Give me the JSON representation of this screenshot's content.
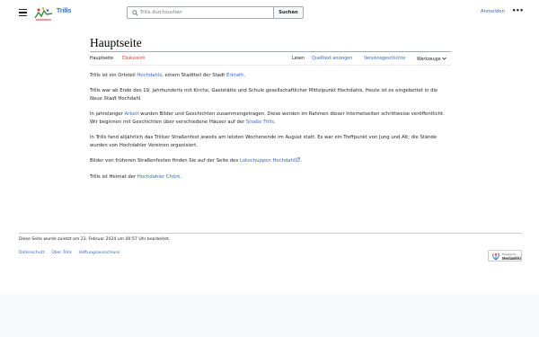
{
  "header": {
    "site_name": "Trills",
    "search_placeholder": "Trills durchsuchen",
    "search_button": "Suchen",
    "login": "Anmelden",
    "more": "•••"
  },
  "page": {
    "title": "Hauptseite",
    "tabs_left": [
      {
        "label": "Hauptseite",
        "state": "active"
      },
      {
        "label": "Diskussion",
        "state": "new"
      }
    ],
    "tabs_right": [
      {
        "label": "Lesen",
        "state": "active"
      },
      {
        "label": "Quelltext anzeigen",
        "state": "link"
      },
      {
        "label": "Versionsgeschichte",
        "state": "link"
      },
      {
        "label": "Werkzeuge",
        "state": "dropdown"
      }
    ]
  },
  "content": {
    "p1": {
      "a": "Trills ist ein Ortsteil ",
      "link1": "Hochdahls",
      "b": ", einem Stadtteil der Stadt ",
      "link2": "Erkrath",
      "c": "."
    },
    "p2": {
      "a": "Trills war ab Ende des 19. Jahrhunderts mit Kirche, Gaststätte und Schule gesellschaftlicher Mittelpunkt Hochdahls. Heute ist es eingebettet in die ",
      "em": "Neue Stadt",
      "b": " Hochdahl."
    },
    "p3": {
      "a": "In jahrelanger ",
      "link1": "Arbeit",
      "b": " wurden Bilder und Geschichten zusammengetragen. Diese werden im Rahmen dieser Internetseiten schrittweise veröffentlicht. Wir beginnen mit Geschichten über verschiedene Häuser auf der ",
      "link2": "Straße Trills",
      "c": "."
    },
    "p4": {
      "a": "In Trills fand alljährlich das Trillser Straßenfest jeweils am letzten Wochenende im August statt. Es war ein Treffpunkt von Jung und Alt; die Stände wurden von Hochdahler Vereinen organisiert."
    },
    "p5": {
      "a": "Bilder von früheren Straßenfesten finden Sie auf der Seite des ",
      "link1": "Lokschuppen Hochdahl",
      "b": "."
    },
    "p6": {
      "a": "Trills ist Heimat der ",
      "link1": "Hochdahler Chöre",
      "b": "."
    }
  },
  "footer": {
    "last_modified": "Diese Seite wurde zuletzt am 23. Februar 2024 um 00:57 Uhr bearbeitet.",
    "links": [
      "Datenschutz",
      "Über Trills",
      "Haftungsausschluss"
    ],
    "powered_line1": "Powered by",
    "powered_line2": "MediaWiki"
  },
  "colors": {
    "link": "#3366cc",
    "new_link": "#d73333",
    "text": "#202122",
    "border": "#a2a9b1"
  },
  "icons": [
    "hamburger-menu-icon",
    "site-logo-icon",
    "search-icon",
    "chevron-down-icon",
    "external-link-icon",
    "mediawiki-logo-icon"
  ]
}
